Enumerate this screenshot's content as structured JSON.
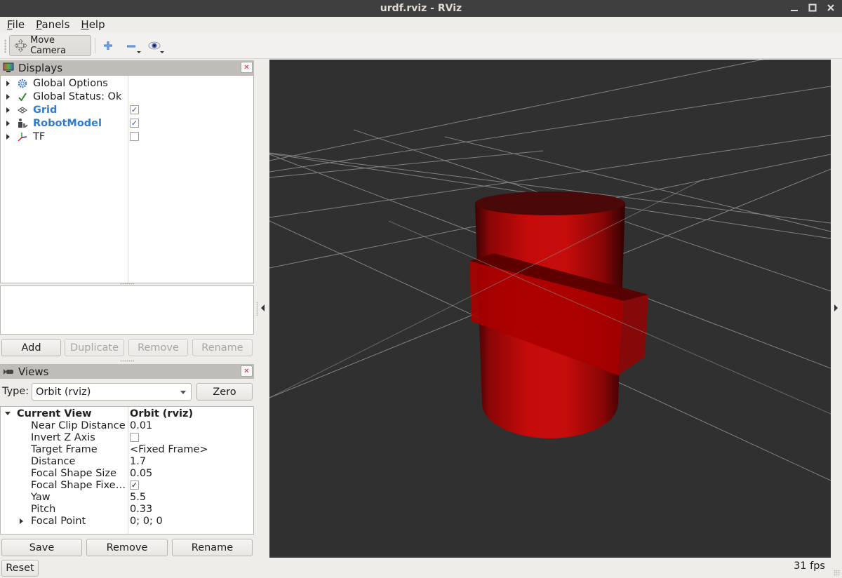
{
  "window": {
    "title": "urdf.rviz - RViz",
    "controls": [
      "minimize",
      "maximize",
      "close"
    ]
  },
  "menu": {
    "items": [
      {
        "label": "File",
        "mnemonic": "F",
        "rest": "ile"
      },
      {
        "label": "Panels",
        "mnemonic": "P",
        "rest": "anels"
      },
      {
        "label": "Help",
        "mnemonic": "H",
        "rest": "elp"
      }
    ]
  },
  "toolbar": {
    "move_camera_label": "Move Camera",
    "tools": [
      {
        "name": "add-tool",
        "icon": "plus-icon"
      },
      {
        "name": "remove-tool",
        "icon": "minus-icon"
      },
      {
        "name": "view-tool",
        "icon": "eye-icon"
      }
    ]
  },
  "displays_panel": {
    "title": "Displays",
    "items": [
      {
        "label": "Global Options",
        "icon": "gear-icon",
        "style": "normal",
        "checkbox": null
      },
      {
        "label": "Global Status: Ok",
        "icon": "checkmark-icon",
        "style": "normal",
        "checkbox": null
      },
      {
        "label": "Grid",
        "icon": "grid-icon",
        "style": "blue-bold",
        "checkbox": true
      },
      {
        "label": "RobotModel",
        "icon": "robot-icon",
        "style": "blue-bold",
        "checkbox": true
      },
      {
        "label": "TF",
        "icon": "axes-icon",
        "style": "normal",
        "checkbox": false
      }
    ],
    "buttons": {
      "add": "Add",
      "duplicate": "Duplicate",
      "remove": "Remove",
      "rename": "Rename"
    }
  },
  "views_panel": {
    "title": "Views",
    "type_label": "Type:",
    "type_value": "Orbit (rviz)",
    "zero_label": "Zero",
    "current_view": {
      "label": "Current View",
      "value": "Orbit (rviz)",
      "properties": [
        {
          "label": "Near Clip Distance",
          "value": "0.01",
          "kind": "text"
        },
        {
          "label": "Invert Z Axis",
          "value": false,
          "kind": "checkbox"
        },
        {
          "label": "Target Frame",
          "value": "<Fixed Frame>",
          "kind": "text"
        },
        {
          "label": "Distance",
          "value": "1.7",
          "kind": "text"
        },
        {
          "label": "Focal Shape Size",
          "value": "0.05",
          "kind": "text"
        },
        {
          "label": "Focal Shape Fixe…",
          "value": true,
          "kind": "checkbox"
        },
        {
          "label": "Yaw",
          "value": "5.5",
          "kind": "text"
        },
        {
          "label": "Pitch",
          "value": "0.33",
          "kind": "text"
        },
        {
          "label": "Focal Point",
          "value": "0; 0; 0",
          "kind": "text",
          "expandable": true
        }
      ]
    },
    "buttons": {
      "save": "Save",
      "remove": "Remove",
      "rename": "Rename"
    }
  },
  "reset_label": "Reset",
  "status": {
    "fps": "31 fps"
  },
  "scene": {
    "background": "#303030",
    "grid_color": "#a0a0a0",
    "robot_color": "#c80a0a"
  }
}
